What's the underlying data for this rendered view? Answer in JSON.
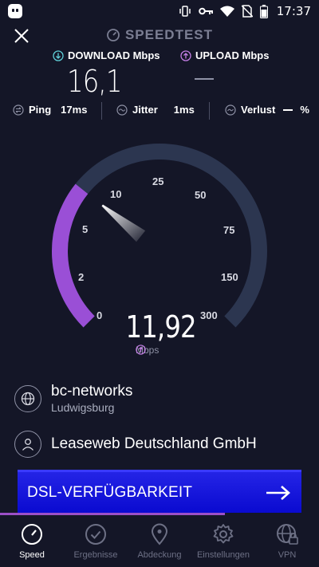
{
  "status_bar": {
    "time": "17:37",
    "icons": [
      "ghostery-icon",
      "vibrate-icon",
      "key-icon",
      "wifi-icon",
      "no-sim-icon",
      "battery-icon"
    ]
  },
  "header": {
    "close_icon": "close-icon",
    "title": "SPEEDTEST",
    "title_icon": "speedometer-icon"
  },
  "download": {
    "label": "DOWNLOAD Mbps",
    "value": "16,1",
    "icon": "download-arrow-icon",
    "accent": "#5fd0d8"
  },
  "upload": {
    "label": "UPLOAD Mbps",
    "value": "",
    "icon": "upload-arrow-icon",
    "accent": "#c37ee5"
  },
  "stats": {
    "ping_label": "Ping",
    "ping_value": "17ms",
    "jitter_label": "Jitter",
    "jitter_value": "1ms",
    "loss_label": "Verlust",
    "loss_value": "%"
  },
  "gauge": {
    "ticks": [
      "0",
      "2",
      "5",
      "10",
      "25",
      "50",
      "75",
      "150",
      "300"
    ],
    "current_value": "11,92",
    "unit": "Mbps",
    "fill_fraction": 0.31,
    "track_color": "#2c3650",
    "fill_color": "#9a4fd6"
  },
  "isp": {
    "name": "bc-networks",
    "location": "Ludwigsburg",
    "icon": "globe-icon"
  },
  "host": {
    "name": "Leaseweb Deutschland GmbH",
    "icon": "user-icon"
  },
  "banner": {
    "text": "DSL-VERFÜGBARKEIT",
    "icon": "arrow-right-icon"
  },
  "progress_fraction": 0.705,
  "nav": {
    "items": [
      {
        "label": "Speed",
        "icon": "speedometer-icon",
        "active": true
      },
      {
        "label": "Ergebnisse",
        "icon": "check-circle-icon",
        "active": false
      },
      {
        "label": "Abdeckung",
        "icon": "map-pin-icon",
        "active": false
      },
      {
        "label": "Einstellungen",
        "icon": "gear-icon",
        "active": false
      },
      {
        "label": "VPN",
        "icon": "vpn-globe-icon",
        "active": false
      }
    ]
  }
}
